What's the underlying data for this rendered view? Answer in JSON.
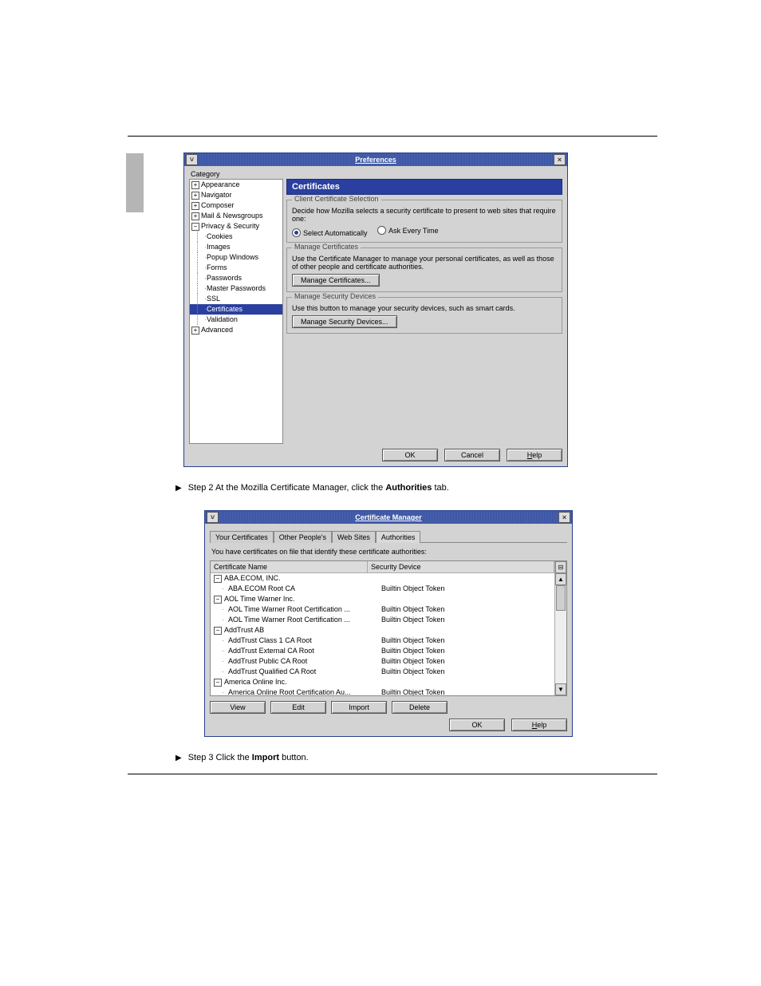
{
  "page": {
    "thumb": true
  },
  "prefs": {
    "title": "Preferences",
    "category_label": "Category",
    "tree": {
      "appearance": "Appearance",
      "navigator": "Navigator",
      "composer": "Composer",
      "mail": "Mail & Newsgroups",
      "privacy": "Privacy & Security",
      "cookies": "Cookies",
      "images": "Images",
      "popup": "Popup Windows",
      "forms": "Forms",
      "passwords": "Passwords",
      "master": "Master Passwords",
      "ssl": "SSL",
      "certificates": "Certificates",
      "validation": "Validation",
      "advanced": "Advanced"
    },
    "panel_title": "Certificates",
    "group_ccs": {
      "legend": "Client Certificate Selection",
      "desc": "Decide how Mozilla selects a security certificate to present to web sites that require one:",
      "opt_auto": "Select Automatically",
      "opt_ask": "Ask Every Time"
    },
    "group_mc": {
      "legend": "Manage Certificates",
      "desc": "Use the Certificate Manager to manage your personal certificates, as well as those of other people and certificate authorities.",
      "btn": "Manage Certificates..."
    },
    "group_msd": {
      "legend": "Manage Security Devices",
      "desc": "Use this button to manage your security devices, such as smart cards.",
      "btn": "Manage Security Devices..."
    },
    "buttons": {
      "ok": "OK",
      "cancel": "Cancel",
      "help": "Help"
    }
  },
  "step1": {
    "prefix": "Step 2   At the Mozilla Certificate Manager, click the ",
    "bold": "Authorities",
    "suffix": " tab."
  },
  "certmgr": {
    "title": "Certificate Manager",
    "tabs": {
      "your": "Your Certificates",
      "other": "Other People's",
      "web": "Web Sites",
      "auth": "Authorities"
    },
    "hint": "You have certificates on file that identify these certificate authorities:",
    "col_name": "Certificate Name",
    "col_device": "Security Device",
    "groups": [
      {
        "name": "ABA.ECOM, INC.",
        "children": [
          {
            "name": "ABA.ECOM Root CA",
            "device": "Builtin Object Token"
          }
        ]
      },
      {
        "name": "AOL Time Warner Inc.",
        "children": [
          {
            "name": "AOL Time Warner Root Certification ...",
            "device": "Builtin Object Token"
          },
          {
            "name": "AOL Time Warner Root Certification ...",
            "device": "Builtin Object Token"
          }
        ]
      },
      {
        "name": "AddTrust AB",
        "children": [
          {
            "name": "AddTrust Class 1 CA Root",
            "device": "Builtin Object Token"
          },
          {
            "name": "AddTrust External CA Root",
            "device": "Builtin Object Token"
          },
          {
            "name": "AddTrust Public CA Root",
            "device": "Builtin Object Token"
          },
          {
            "name": "AddTrust Qualified CA Root",
            "device": "Builtin Object Token"
          }
        ]
      },
      {
        "name": "America Online Inc.",
        "children": [
          {
            "name": "America Online Root Certification Au...",
            "device": "Builtin Object Token"
          }
        ]
      }
    ],
    "toolbar": {
      "view": "View",
      "edit": "Edit",
      "import": "Import",
      "delete": "Delete"
    },
    "buttons": {
      "ok": "OK",
      "help": "Help"
    }
  },
  "step2": {
    "prefix": "Step 3   Click the ",
    "bold": "Import",
    "suffix": " button."
  }
}
